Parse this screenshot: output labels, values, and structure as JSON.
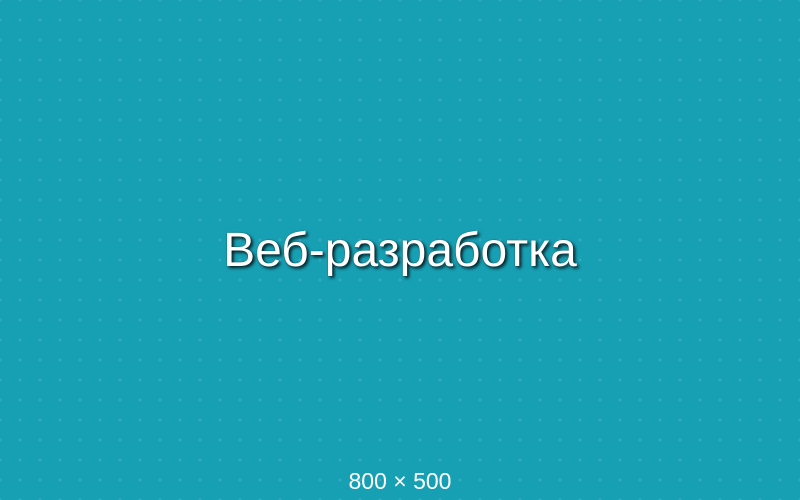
{
  "banner": {
    "background_color": "#17a0b4",
    "title": "Веб-разработка",
    "caption": "800 × 500"
  }
}
